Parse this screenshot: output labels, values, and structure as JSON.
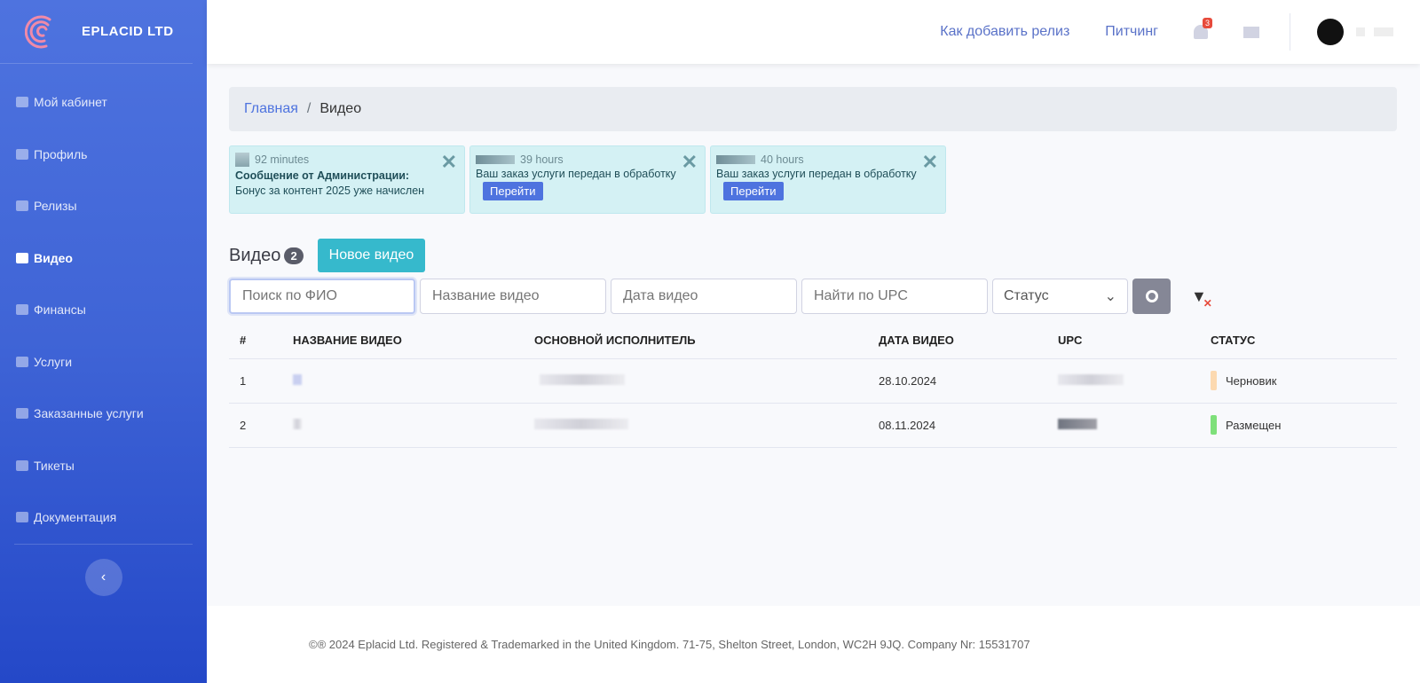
{
  "brand": {
    "name": "EPLACID LTD"
  },
  "sidebar": {
    "items": [
      {
        "label": "Мой кабинет",
        "icon": "cube-icon"
      },
      {
        "label": "Профиль",
        "icon": "user-cog-icon"
      },
      {
        "label": "Релизы",
        "icon": "headphones-icon"
      },
      {
        "label": "Видео",
        "icon": "video-icon",
        "active": true
      },
      {
        "label": "Финансы",
        "icon": "money-icon"
      },
      {
        "label": "Услуги",
        "icon": "cube-icon"
      },
      {
        "label": "Заказанные услуги",
        "icon": "cube-icon"
      },
      {
        "label": "Тикеты",
        "icon": "envelope-icon"
      },
      {
        "label": "Документация",
        "icon": "briefcase-icon"
      }
    ],
    "collapse": "‹"
  },
  "topbar": {
    "link1": "Как добавить релиз",
    "link2": "Питчинг",
    "notifications": "3"
  },
  "breadcrumb": {
    "home": "Главная",
    "sep": "/",
    "current": "Видео"
  },
  "toasts": [
    {
      "time": "92 minutes",
      "title": "Сообщение от Администрации:",
      "text": "Бонус за контент 2025 уже начислен",
      "close": "✕"
    },
    {
      "time": "39 hours",
      "text": "Ваш заказ услуги передан в обработку",
      "button": "Перейти",
      "close": "✕"
    },
    {
      "time": "40 hours",
      "text": "Ваш заказ услуги передан в обработку",
      "button": "Перейти",
      "close": "✕"
    }
  ],
  "page": {
    "title": "Видео",
    "count": "2",
    "new_button": "Новое видео"
  },
  "filters": {
    "fio": "Поиск по ФИО",
    "name": "Название видео",
    "date": "Дата видео",
    "upc": "Найти по UPC",
    "status": "Статус"
  },
  "table": {
    "headers": [
      "#",
      "НАЗВАНИЕ ВИДЕО",
      "ОСНОВНОЙ ИСПОЛНИТЕЛЬ",
      "ДАТА ВИДЕО",
      "UPC",
      "СТАТУС"
    ],
    "rows": [
      {
        "num": "1",
        "date": "28.10.2024",
        "status": "Черновик",
        "status_color": "#fcd9b0"
      },
      {
        "num": "2",
        "date": "08.11.2024",
        "status": "Размещен",
        "status_color": "#7ee07a"
      }
    ]
  },
  "footer": "©® 2024 Eplacid Ltd. Registered & Trademarked in the United Kingdom. 71-75, Shelton Street, London, WC2H 9JQ. Company Nr: 15531707"
}
